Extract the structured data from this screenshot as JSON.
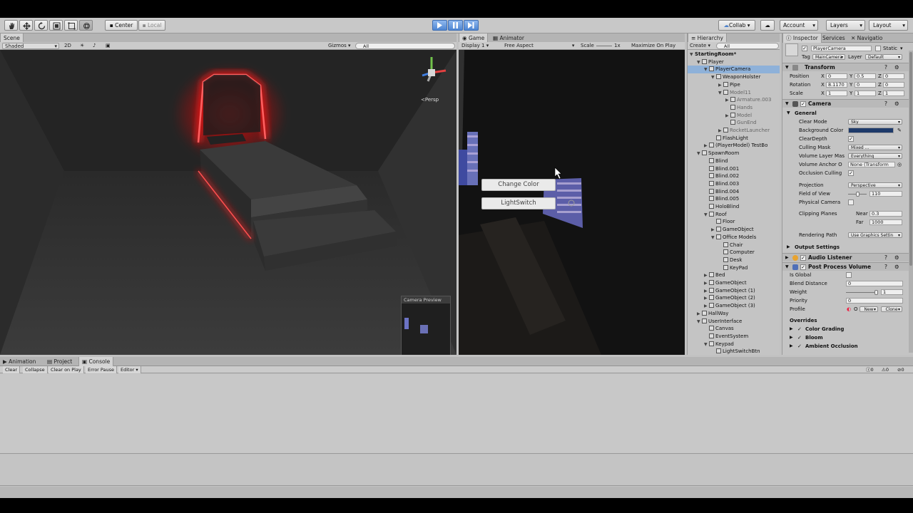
{
  "toolbar": {
    "pivot_label": "Center",
    "space_label": "Local",
    "collab_label": "Collab",
    "account_label": "Account",
    "layers_label": "Layers",
    "layout_label": "Layout"
  },
  "scene": {
    "tab_label": "Scene",
    "shading_mode": "Shaded",
    "mode_2d": "2D",
    "gizmos_label": "Gizmos",
    "search_placeholder": "All",
    "persp_label": "Persp",
    "camera_preview_label": "Camera Preview"
  },
  "game": {
    "tab_label": "Game",
    "animator_tab_label": "Animator",
    "display_label": "Display 1",
    "aspect_label": "Free Aspect",
    "scale_label": "Scale",
    "scale_value": "1x",
    "maximize_label": "Maximize On Play",
    "buttons": [
      "Change Color",
      "LightSwitch"
    ]
  },
  "hierarchy": {
    "tab_label": "Hierarchy",
    "create_label": "Create",
    "search_placeholder": "All",
    "items": [
      {
        "label": "StartingRoom*",
        "depth": 0,
        "arrow": "▼",
        "scene": true
      },
      {
        "label": "Player",
        "depth": 1,
        "arrow": "▼"
      },
      {
        "label": "PlayerCamera",
        "depth": 2,
        "arrow": "▼",
        "selected": true
      },
      {
        "label": "WeaponHolster",
        "depth": 3,
        "arrow": "▼"
      },
      {
        "label": "Pipe",
        "depth": 4,
        "arrow": "▶"
      },
      {
        "label": "Model11",
        "depth": 4,
        "arrow": "▼",
        "grey": true
      },
      {
        "label": "Armature.003",
        "depth": 5,
        "arrow": "▶",
        "grey": true
      },
      {
        "label": "Hands",
        "depth": 5,
        "arrow": "",
        "grey": true
      },
      {
        "label": "Model",
        "depth": 5,
        "arrow": "▶",
        "grey": true
      },
      {
        "label": "GunEnd",
        "depth": 5,
        "arrow": "",
        "grey": true
      },
      {
        "label": "RocketLauncher",
        "depth": 4,
        "arrow": "▶",
        "grey": true
      },
      {
        "label": "FlashLight",
        "depth": 3,
        "arrow": ""
      },
      {
        "label": "(PlayerModel) TestBo",
        "depth": 2,
        "arrow": "▶"
      },
      {
        "label": "SpawnRoom",
        "depth": 1,
        "arrow": "▼"
      },
      {
        "label": "Blind",
        "depth": 2,
        "arrow": ""
      },
      {
        "label": "Blind.001",
        "depth": 2,
        "arrow": ""
      },
      {
        "label": "Blind.002",
        "depth": 2,
        "arrow": ""
      },
      {
        "label": "Blind.003",
        "depth": 2,
        "arrow": ""
      },
      {
        "label": "Blind.004",
        "depth": 2,
        "arrow": ""
      },
      {
        "label": "Blind.005",
        "depth": 2,
        "arrow": ""
      },
      {
        "label": "HoloBlind",
        "depth": 2,
        "arrow": ""
      },
      {
        "label": "Roof",
        "depth": 2,
        "arrow": "▼"
      },
      {
        "label": "Floor",
        "depth": 3,
        "arrow": ""
      },
      {
        "label": "GameObject",
        "depth": 3,
        "arrow": "▶"
      },
      {
        "label": "Office Models",
        "depth": 3,
        "arrow": "▼"
      },
      {
        "label": "Chair",
        "depth": 4,
        "arrow": ""
      },
      {
        "label": "Computer",
        "depth": 4,
        "arrow": ""
      },
      {
        "label": "Desk",
        "depth": 4,
        "arrow": ""
      },
      {
        "label": "KeyPad",
        "depth": 4,
        "arrow": ""
      },
      {
        "label": "Bed",
        "depth": 2,
        "arrow": "▶"
      },
      {
        "label": "GameObject",
        "depth": 2,
        "arrow": "▶"
      },
      {
        "label": "GameObject (1)",
        "depth": 2,
        "arrow": "▶"
      },
      {
        "label": "GameObject (2)",
        "depth": 2,
        "arrow": "▶"
      },
      {
        "label": "GameObject (3)",
        "depth": 2,
        "arrow": "▶"
      },
      {
        "label": "HallWay",
        "depth": 1,
        "arrow": "▶"
      },
      {
        "label": "UserInterface",
        "depth": 1,
        "arrow": "▼"
      },
      {
        "label": "Canvas",
        "depth": 2,
        "arrow": ""
      },
      {
        "label": "EventSystem",
        "depth": 2,
        "arrow": ""
      },
      {
        "label": "Keypad",
        "depth": 2,
        "arrow": "▼"
      },
      {
        "label": "LightSwitchBtn",
        "depth": 3,
        "arrow": ""
      }
    ]
  },
  "inspector": {
    "tab_label": "Inspector",
    "services_label": "Services",
    "navigation_label": "Navigatio",
    "object_name": "PlayerCamera",
    "static_label": "Static",
    "tag_label": "Tag",
    "tag_value": "MainCamera",
    "layer_label": "Layer",
    "layer_value": "Default",
    "transform": {
      "title": "Transform",
      "position_label": "Position",
      "position": [
        "0",
        "0.5",
        "0"
      ],
      "rotation_label": "Rotation",
      "rotation": [
        "8.1170",
        "0",
        "0"
      ],
      "scale_label": "Scale",
      "scale": [
        "1",
        "1",
        "1"
      ],
      "axes": [
        "X",
        "Y",
        "Z"
      ]
    },
    "camera": {
      "title": "Camera",
      "general_label": "General",
      "clear_mode_label": "Clear Mode",
      "clear_mode_value": "Sky",
      "background_label": "Background Color",
      "clear_depth_label": "ClearDepth",
      "culling_mask_label": "Culling Mask",
      "culling_mask_value": "Mixed ...",
      "volume_layer_label": "Volume Layer Mas",
      "volume_layer_value": "Everything",
      "volume_anchor_label": "Volume Anchor O",
      "volume_anchor_value": "None (Transform",
      "occlusion_label": "Occlusion Culling",
      "projection_label": "Projection",
      "projection_value": "Perspective",
      "fov_label": "Field of View",
      "fov_value": "110",
      "fov_fraction": 0.55,
      "physical_label": "Physical Camera",
      "clipping_label": "Clipping Planes",
      "near_label": "Near",
      "near_value": "0.3",
      "far_label": "Far",
      "far_value": "1000",
      "rendering_path_label": "Rendering Path",
      "rendering_path_value": "Use Graphics Settin",
      "output_label": "Output Settings"
    },
    "audio_listener_title": "Audio Listener",
    "post_process": {
      "title": "Post Process Volume",
      "is_global_label": "Is Global",
      "blend_label": "Blend Distance",
      "blend_value": "0",
      "weight_label": "Weight",
      "weight_value": "1",
      "weight_fraction": 0.95,
      "priority_label": "Priority",
      "priority_value": "0",
      "profile_label": "Profile",
      "profile_value": "O",
      "new_label": "New",
      "clone_label": "Clone",
      "overrides_label": "Overrides",
      "overrides": [
        "Color Grading",
        "Bloom",
        "Ambient Occlusion"
      ]
    }
  },
  "console": {
    "tabs": [
      "Animation",
      "Project",
      "Console"
    ],
    "buttons": [
      "Clear",
      "Collapse",
      "Clear on Play",
      "Error Pause",
      "Editor"
    ],
    "count_logs": "0",
    "count_warnings": "0",
    "count_errors": "0"
  },
  "colors": {
    "selection": "#8eb1d9",
    "play_active": "#4f86d2",
    "neon_red": "#ff1a1a",
    "background_color_swatch": "#1e3a6a"
  }
}
